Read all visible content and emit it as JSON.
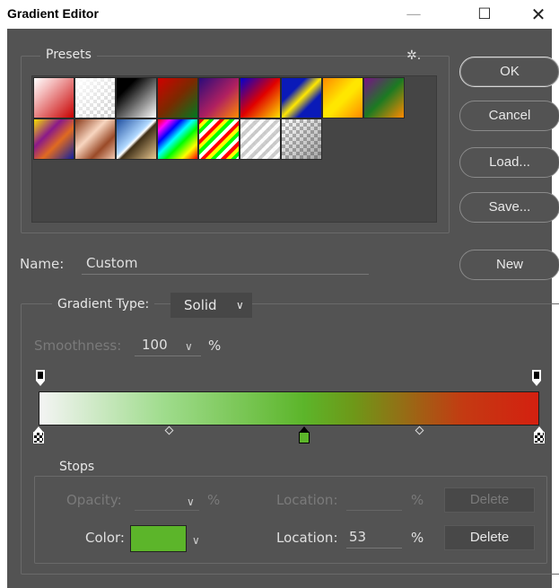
{
  "window": {
    "title": "Gradient Editor",
    "minimize_glyph": "—",
    "maximize_glyph": "☐",
    "close_glyph": "✕"
  },
  "presets": {
    "legend": "Presets",
    "gear_glyph": "✲.",
    "swatches": [
      {
        "name": "white-to-red",
        "css": "linear-gradient(135deg,#ffffff 0%,#f3b9b9 30%,#c80000 100%)"
      },
      {
        "name": "foreground-to-transparent",
        "css": "linear-gradient(135deg,rgba(255,255,255,1) 0%,rgba(255,255,255,0) 100%),repeating-conic-gradient(#cfcfcf 0 25%,#ffffff 0 50%) 0 0/8px 8px"
      },
      {
        "name": "black-to-white",
        "css": "linear-gradient(135deg,#000000 0%,#000000 25%,#ffffff 100%)"
      },
      {
        "name": "red-green",
        "css": "linear-gradient(135deg,#d10000 0%,#7a2a00 50%,#007a20 100%)"
      },
      {
        "name": "violet-orange",
        "css": "linear-gradient(135deg,#2b0b7a 0%,#b02060 55%,#ff8a00 100%)"
      },
      {
        "name": "blue-red-yellow",
        "css": "linear-gradient(135deg,#0000d0 0%,#e00000 50%,#ffe000 100%)"
      },
      {
        "name": "blue-yellow-blue",
        "css": "linear-gradient(135deg,#0a1ab8 0%,#0a1ab8 30%,#ffe800 50%,#0a1ab8 70%,#0a1ab8 100%)"
      },
      {
        "name": "orange-yellow-orange",
        "css": "linear-gradient(135deg,#ff8800 0%,#ffe600 45%,#ffe600 55%,#ff8800 100%)"
      },
      {
        "name": "violet-green-orange",
        "css": "linear-gradient(135deg,#7a1088 0%,#1c7a22 50%,#ff8a00 100%)"
      },
      {
        "name": "yellow-violet-orange-blue",
        "css": "linear-gradient(135deg,#f8e000 0%,#8a1a8a 35%,#e06a20 60%,#1020a0 100%)"
      },
      {
        "name": "copper",
        "css": "linear-gradient(135deg,#8a3a1a 0%,#f8d6c0 40%,#9a4a28 70%,#f0c8b0 100%)"
      },
      {
        "name": "chrome",
        "css": "linear-gradient(135deg,#2050a0 0%,#b0d8ff 45%,#ffffff 50%,#403018 55%,#e8c890 100%)"
      },
      {
        "name": "spectrum",
        "css": "linear-gradient(135deg,#ff0000 0%,#ff00ff 15%,#0000ff 30%,#00ffff 45%,#00ff00 60%,#ffff00 80%,#ff0000 100%)"
      },
      {
        "name": "transparent-rainbow",
        "css": "repeating-linear-gradient(135deg,#ff0000 0 4px,#ffff00 4px 8px,#00ff00 8px 12px,#ffffff 12px 16px),#ffffff"
      },
      {
        "name": "transparent-stripes",
        "css": "repeating-linear-gradient(135deg,rgba(255,255,255,0.9) 0 4px,rgba(200,200,200,0.9) 4px 8px),repeating-conic-gradient(#cfcfcf 0 25%,#ffffff 0 50%) 0 0/8px 8px"
      },
      {
        "name": "neutral-density",
        "css": "linear-gradient(135deg,rgba(0,0,0,0) 0%,rgba(0,0,0,0.35) 100%),repeating-conic-gradient(#bdbdbd 0 25%,#ffffff 0 50%) 0 0/8px 8px"
      }
    ]
  },
  "buttons": {
    "ok": "OK",
    "cancel": "Cancel",
    "load": "Load...",
    "save": "Save...",
    "new": "New"
  },
  "name_field": {
    "label": "Name:",
    "value": "Custom"
  },
  "gradient_type": {
    "label": "Gradient Type:",
    "value": "Solid",
    "chevron": "∨"
  },
  "smoothness": {
    "label": "Smoothness:",
    "value": "100",
    "chevron": "∨",
    "unit": "%"
  },
  "gradient": {
    "css": "linear-gradient(to right,#f4f4f4 0%,#9fdc8c 25%,#5cb52a 53%,#6e9818 63%,#c43a12 85%,#d42010 100%)",
    "color_stops": [
      {
        "location": 0,
        "color": "#f4f4f4"
      },
      {
        "location": 53,
        "color": "#5cb52a"
      },
      {
        "location": 100,
        "color": "#d42010"
      }
    ],
    "midpoints": [
      26,
      76
    ],
    "opacity_stops": [
      0,
      100
    ],
    "selected_stop_location": 53
  },
  "stops": {
    "legend": "Stops",
    "opacity_label": "Opacity:",
    "opacity_unit": "%",
    "opacity_location_label": "Location:",
    "opacity_location_unit": "%",
    "opacity_delete": "Delete",
    "color_label": "Color:",
    "color_value": "#5cb52a",
    "color_chevron": "∨",
    "color_location_label": "Location:",
    "color_location_value": "53",
    "color_location_unit": "%",
    "color_delete": "Delete"
  }
}
